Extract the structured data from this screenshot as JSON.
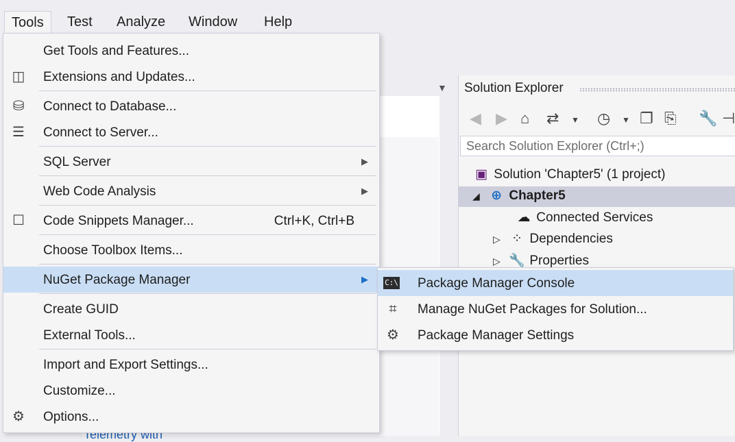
{
  "menubar": {
    "items": [
      {
        "label": "Tools"
      },
      {
        "label": "Test"
      },
      {
        "label": "Analyze"
      },
      {
        "label": "Window"
      },
      {
        "label": "Help"
      }
    ]
  },
  "tools_menu": {
    "items": [
      {
        "label": "Get Tools and Features..."
      },
      {
        "label": "Extensions and Updates..."
      },
      {
        "label": "Connect to Database..."
      },
      {
        "label": "Connect to Server..."
      },
      {
        "label": "SQL Server"
      },
      {
        "label": "Web Code Analysis"
      },
      {
        "label": "Code Snippets Manager...",
        "shortcut": "Ctrl+K, Ctrl+B"
      },
      {
        "label": "Choose Toolbox Items..."
      },
      {
        "label": "NuGet Package Manager"
      },
      {
        "label": "Create GUID"
      },
      {
        "label": "External Tools..."
      },
      {
        "label": "Import and Export Settings..."
      },
      {
        "label": "Customize..."
      },
      {
        "label": "Options..."
      }
    ]
  },
  "nuget_submenu": {
    "items": [
      {
        "label": "Package Manager Console",
        "icon": "console-icon"
      },
      {
        "label": "Manage NuGet Packages for Solution...",
        "icon": "package-icon"
      },
      {
        "label": "Package Manager Settings",
        "icon": "gear-icon"
      }
    ]
  },
  "solution_explorer": {
    "title": "Solution Explorer",
    "search_placeholder": "Search Solution Explorer (Ctrl+;)",
    "tree": {
      "solution": "Solution 'Chapter5' (1 project)",
      "project": "Chapter5",
      "connected_services": "Connected Services",
      "dependencies": "Dependencies",
      "properties": "Properties"
    }
  },
  "editor": {
    "partial_text": "Telemetry with"
  },
  "colors": {
    "highlight": "#c9def5",
    "menu_bg": "#f5f5f5",
    "border": "#cccedb",
    "selection": "#cccedb"
  }
}
